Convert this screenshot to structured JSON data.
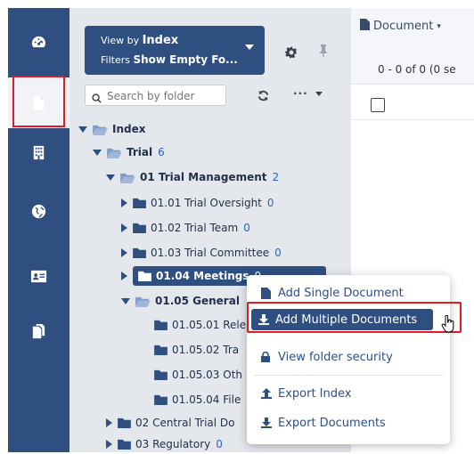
{
  "rail": {
    "items": [
      {
        "icon": "dashboard-icon"
      },
      {
        "icon": "document-icon",
        "active": true
      },
      {
        "icon": "building-icon"
      },
      {
        "icon": "globe-icon"
      },
      {
        "icon": "contact-card-icon"
      },
      {
        "icon": "documents-icon"
      }
    ],
    "accent": "#2f4f80",
    "highlight_color": "#e31b23"
  },
  "panel": {
    "view_by_label": "View by",
    "view_by_value": "Index",
    "filters_label": "Filters",
    "filters_value": "Show Empty Fo...",
    "search_placeholder": "Search by folder"
  },
  "tree": [
    {
      "label": "Index",
      "count": ""
    },
    {
      "label": "Trial",
      "count": "6"
    },
    {
      "label": "01 Trial Management",
      "count": "2"
    },
    {
      "label": "01.01 Trial Oversight",
      "count": "0"
    },
    {
      "label": "01.02 Trial Team",
      "count": "0"
    },
    {
      "label": "01.03 Trial Committee",
      "count": "0"
    },
    {
      "label": "01.04 Meetings",
      "count": "0"
    },
    {
      "label": "01.05 General",
      "count": ""
    },
    {
      "label": "01.05.01 Rele",
      "count": ""
    },
    {
      "label": "01.05.02 Tra",
      "count": ""
    },
    {
      "label": "01.05.03 Oth",
      "count": ""
    },
    {
      "label": "01.05.04 File",
      "count": ""
    },
    {
      "label": "02 Central Trial Do",
      "count": ""
    },
    {
      "label": "03 Regulatory",
      "count": "0"
    }
  ],
  "content": {
    "document_tab": "Document",
    "pager": "0 - 0 of 0 (0 se"
  },
  "menu": {
    "items": [
      {
        "label": "Add Single Document",
        "icon": "file-icon"
      },
      {
        "label": "Add Multiple Documents",
        "icon": "download-icon",
        "highlighted": true
      },
      {
        "label": "View folder security",
        "icon": "lock-icon"
      },
      {
        "label": "Export Index",
        "icon": "upload-icon"
      },
      {
        "label": "Export Documents",
        "icon": "download-icon"
      }
    ]
  }
}
